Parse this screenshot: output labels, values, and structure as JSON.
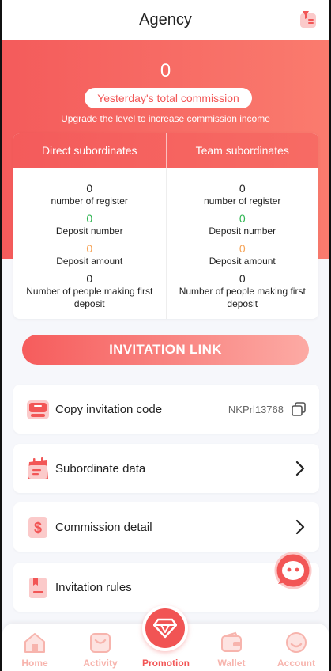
{
  "header": {
    "title": "Agency",
    "filter_icon": "filter-icon"
  },
  "summary": {
    "yesterday_total": "0",
    "yesterday_label": "Yesterday's total commission",
    "upgrade_note": "Upgrade the level to increase commission income"
  },
  "stats": {
    "direct": {
      "heading": "Direct subordinates",
      "register_value": "0",
      "register_label": "number of register",
      "deposit_number_value": "0",
      "deposit_number_label": "Deposit number",
      "deposit_amount_value": "0",
      "deposit_amount_label": "Deposit amount",
      "first_deposit_value": "0",
      "first_deposit_label": "Number of people making first deposit"
    },
    "team": {
      "heading": "Team subordinates",
      "register_value": "0",
      "register_label": "number of register",
      "deposit_number_value": "0",
      "deposit_number_label": "Deposit number",
      "deposit_amount_value": "0",
      "deposit_amount_label": "Deposit amount",
      "first_deposit_value": "0",
      "first_deposit_label": "Number of people making first deposit"
    }
  },
  "invite_button": "INVITATION LINK",
  "menu": {
    "copy_code": {
      "label": "Copy invitation code",
      "code": "NKPrl13768",
      "icon": "invitation-code-icon"
    },
    "subordinate_data": {
      "label": "Subordinate data",
      "icon": "calendar-icon"
    },
    "commission_detail": {
      "label": "Commission detail",
      "icon": "dollar-icon"
    },
    "invitation_rules": {
      "label": "Invitation rules",
      "icon": "rules-book-icon"
    }
  },
  "tabbar": {
    "home": "Home",
    "activity": "Activity",
    "promotion": "Promotion",
    "wallet": "Wallet",
    "account": "Account",
    "active": "promotion"
  },
  "colors": {
    "brand": "#f25656",
    "green": "#2db450",
    "orange": "#f5a255",
    "muted_tab": "#f7b4ad"
  }
}
